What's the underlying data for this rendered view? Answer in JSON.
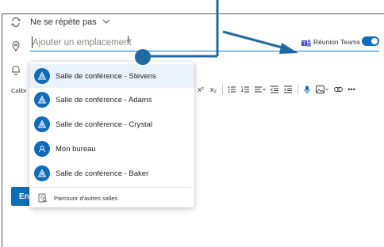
{
  "recurrence": {
    "label": "Ne se répète pas"
  },
  "location": {
    "placeholder": "Ajouter un emplacement"
  },
  "teams": {
    "label": "Réunion Teams",
    "enabled": true
  },
  "editor": {
    "font_name": "Calibr"
  },
  "toolbar": {
    "superscript": "x²",
    "subscript": "x₂",
    "more": "•••"
  },
  "send": {
    "label": "En"
  },
  "dropdown": {
    "rooms": [
      {
        "label": "Salle de conférence - Stevens"
      },
      {
        "label": "Salle de conférence - Adams"
      },
      {
        "label": "Salle de conférence - Crystal"
      },
      {
        "label": "Mon bureau"
      },
      {
        "label": "Salle de conférence - Baker"
      }
    ],
    "browse_label": "Parcourir d'autres salles"
  },
  "colors": {
    "accent": "#0f6cbd",
    "callout": "#1f6aa5",
    "highlight": "#eaf2fb"
  },
  "icons": [
    "recurrence-icon",
    "location-pin-icon",
    "reminder-bell-icon",
    "teams-icon",
    "room-icon",
    "browse-rooms-icon"
  ]
}
